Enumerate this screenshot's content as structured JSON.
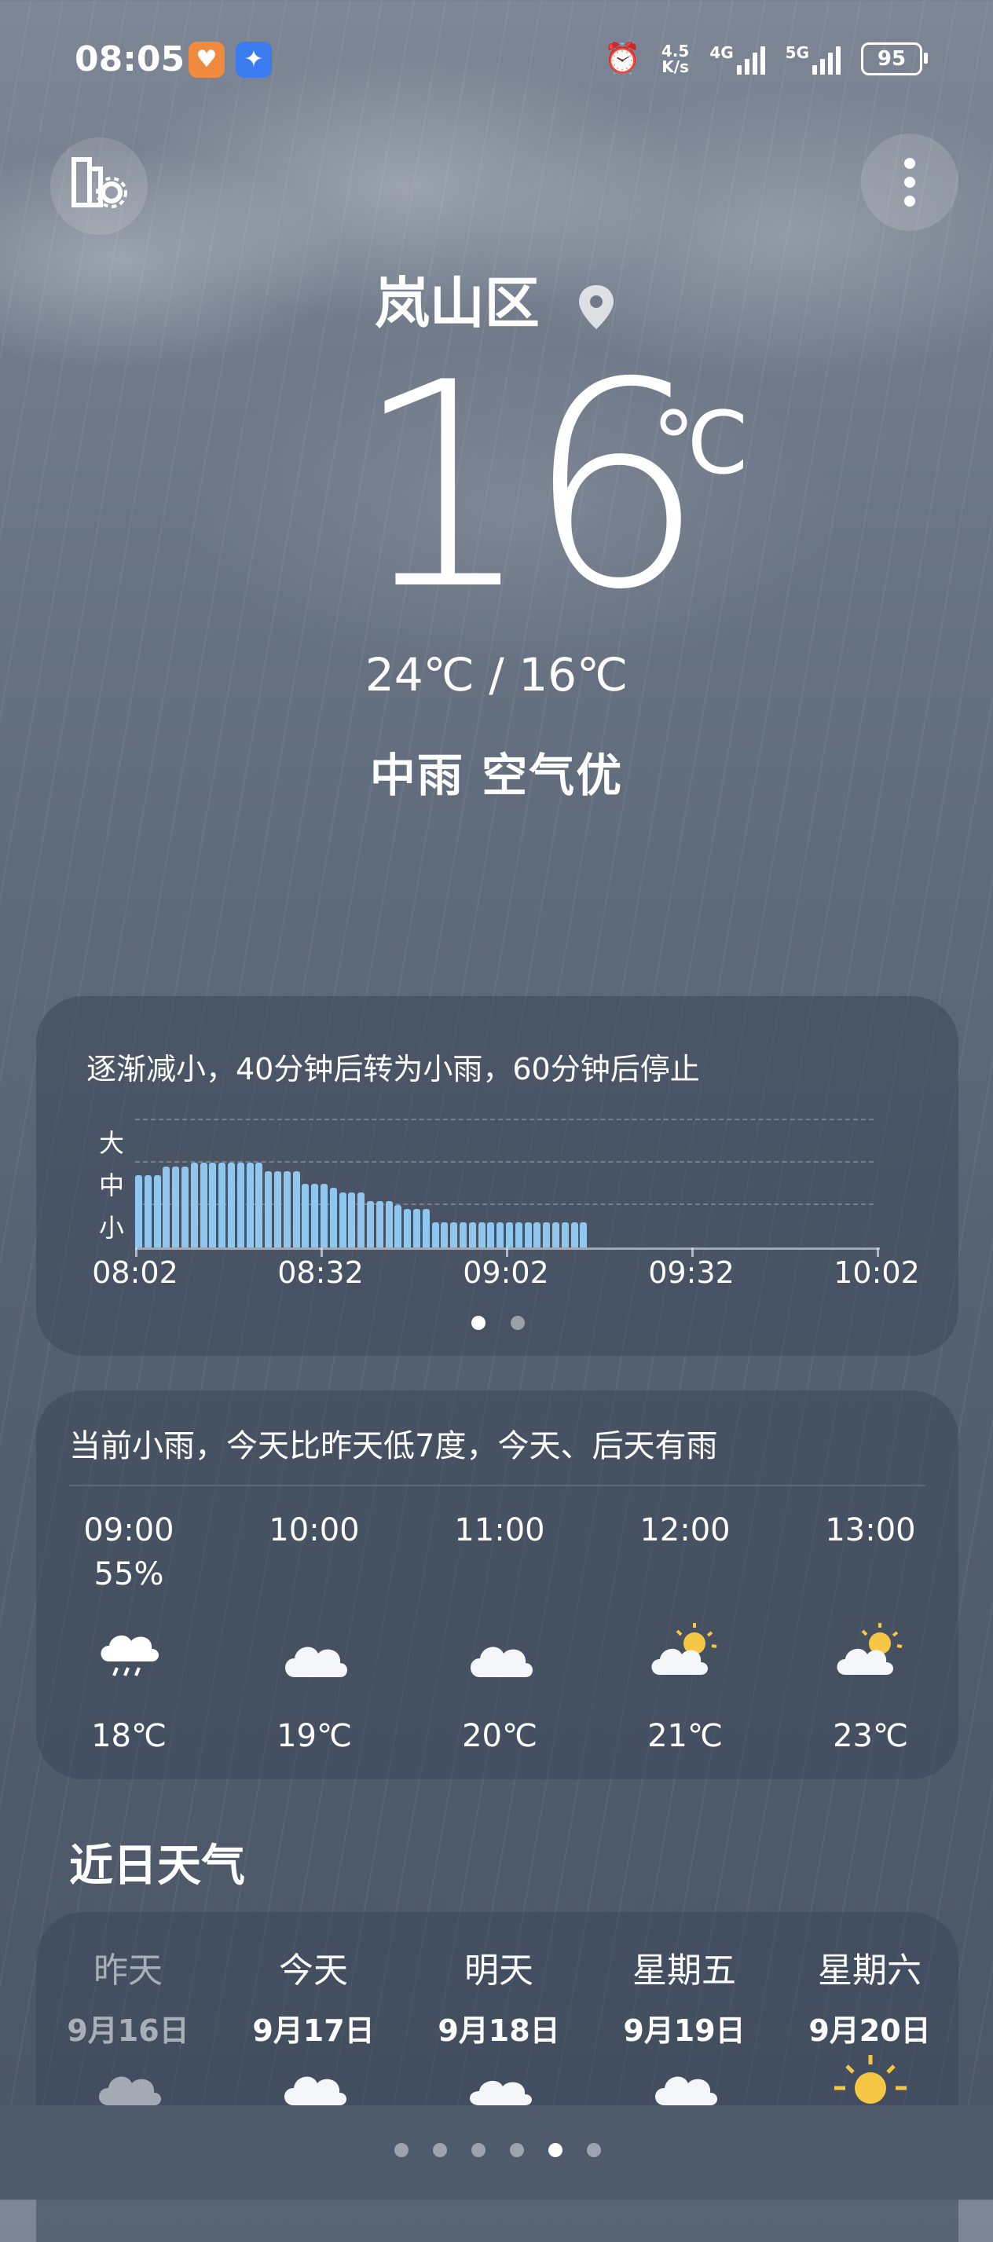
{
  "status_bar": {
    "time": "08:05",
    "net_speed_top": "4.5",
    "net_speed_bottom": "K/s",
    "net_4g": "4G",
    "net_5g": "5G",
    "battery": "95"
  },
  "location": {
    "city": "岚山区"
  },
  "current": {
    "temp": "16",
    "unit": "℃",
    "range": "24℃ / 16℃",
    "condition": "中雨  空气优"
  },
  "precip_card": {
    "summary": "逐渐减小，40分钟后转为小雨，60分钟后停止",
    "y_levels": [
      "大",
      "中",
      "小"
    ],
    "page_dots": 2,
    "active_dot": 0
  },
  "chart_data": {
    "type": "bar",
    "xlabel": "",
    "ylabel": "",
    "x_ticks": [
      "08:02",
      "08:32",
      "09:02",
      "09:32",
      "10:02"
    ],
    "ylim": [
      0,
      3
    ],
    "y_tick_labels": [
      "小",
      "中",
      "大"
    ],
    "grid": true,
    "bar_interval_minutes": 1.5,
    "values": [
      1.7,
      1.7,
      1.7,
      1.9,
      1.9,
      1.9,
      2.0,
      2.0,
      2.0,
      2.0,
      2.0,
      2.0,
      2.0,
      2.0,
      1.8,
      1.8,
      1.8,
      1.8,
      1.5,
      1.5,
      1.5,
      1.4,
      1.3,
      1.3,
      1.3,
      1.1,
      1.1,
      1.1,
      1.0,
      0.9,
      0.9,
      0.9,
      0.6,
      0.6,
      0.6,
      0.6,
      0.6,
      0.6,
      0.6,
      0.6,
      0.6,
      0.6,
      0.6,
      0.6,
      0.6,
      0.6,
      0.6,
      0.6,
      0.6
    ]
  },
  "hourly_card": {
    "summary": "当前小雨，今天比昨天低7度，今天、后天有雨",
    "hours": [
      {
        "time": "09:00",
        "precip": "55%",
        "icon": "rain-cloud-icon",
        "temp": "18℃"
      },
      {
        "time": "10:00",
        "precip": "",
        "icon": "cloud-icon",
        "temp": "19℃"
      },
      {
        "time": "11:00",
        "precip": "",
        "icon": "cloud-icon",
        "temp": "20℃"
      },
      {
        "time": "12:00",
        "precip": "",
        "icon": "partly-sunny-icon",
        "temp": "21℃"
      },
      {
        "time": "13:00",
        "precip": "",
        "icon": "partly-sunny-icon",
        "temp": "23℃"
      }
    ]
  },
  "daily": {
    "section_title": "近日天气",
    "days": [
      {
        "day": "昨天",
        "date": "9月16日",
        "icon": "cloud-icon"
      },
      {
        "day": "今天",
        "date": "9月17日",
        "icon": "cloud-icon"
      },
      {
        "day": "明天",
        "date": "9月18日",
        "icon": "cloud-icon"
      },
      {
        "day": "星期五",
        "date": "9月19日",
        "icon": "cloud-icon"
      },
      {
        "day": "星期六",
        "date": "9月20日",
        "icon": "sun-icon"
      }
    ]
  },
  "pager": {
    "count": 6,
    "active": 4
  },
  "colors": {
    "precip_bar": "#8fc7ef",
    "sun": "#f6c744"
  }
}
